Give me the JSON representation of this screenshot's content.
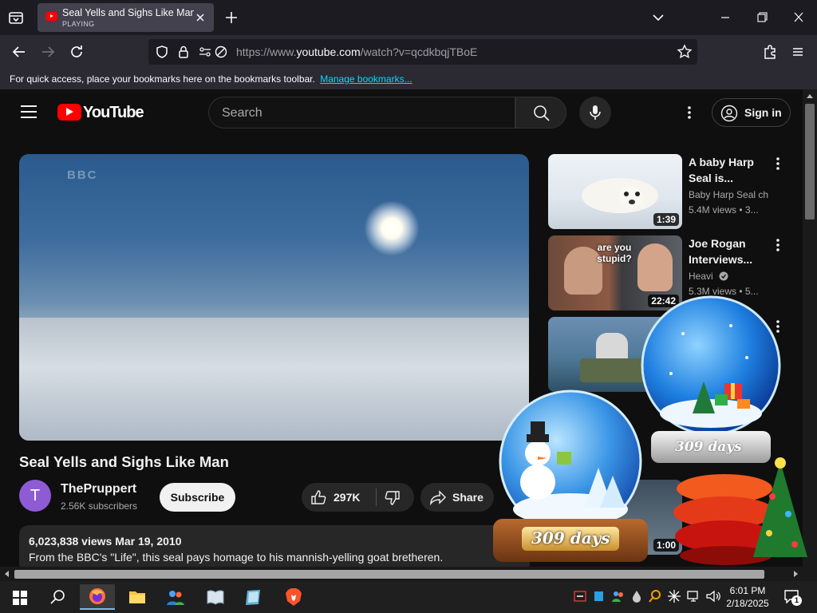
{
  "browser": {
    "tab": {
      "title": "Seal Yells and Sighs Like Man - YouTube",
      "status": "PLAYING"
    },
    "url": {
      "prefix": "https://www.",
      "domain": "youtube.com",
      "path": "/watch?v=qcdkbqjTBoE"
    },
    "bookmarks_bar": {
      "message": "For quick access, place your bookmarks here on the bookmarks toolbar.",
      "link": "Manage bookmarks..."
    }
  },
  "youtube": {
    "logo_text": "YouTube",
    "search_placeholder": "Search",
    "sign_in": "Sign in",
    "video": {
      "watermark": "BBC",
      "title": "Seal Yells and Sighs Like Man",
      "channel": "ThePruppert",
      "channel_initial": "T",
      "subscribers": "2.56K subscribers",
      "subscribe_label": "Subscribe",
      "likes": "297K",
      "share_label": "Share",
      "views_date": "6,023,838 views  Mar 19, 2010",
      "description": "From the BBC's \"Life\", this seal pays homage to his mannish-yelling goat bretheren."
    },
    "recommendations": [
      {
        "title": "A baby Harp Seal is...",
        "channel": "Baby Harp Seal ch",
        "views": "5.4M views  • 3...",
        "duration": "1:39"
      },
      {
        "title": "Joe Rogan Interviews...",
        "channel": "Heavi",
        "views": "5.3M views  • 5...",
        "duration": "22:42",
        "thumb_text": "are you stupid?"
      },
      {
        "title": "",
        "channel": "",
        "views": "",
        "duration": ""
      },
      {
        "title": "",
        "channel": "",
        "views": "",
        "duration": "1:00"
      }
    ]
  },
  "widgets": {
    "globe_left_label": "309 days",
    "globe_right_label": "309 days"
  },
  "taskbar": {
    "time": "6:01 PM",
    "date": "2/18/2025",
    "notification_count": "1"
  },
  "colors": {
    "youtube_red": "#ff0000",
    "link_blue": "#00ddff",
    "channel_avatar": "#8e5bd5"
  }
}
